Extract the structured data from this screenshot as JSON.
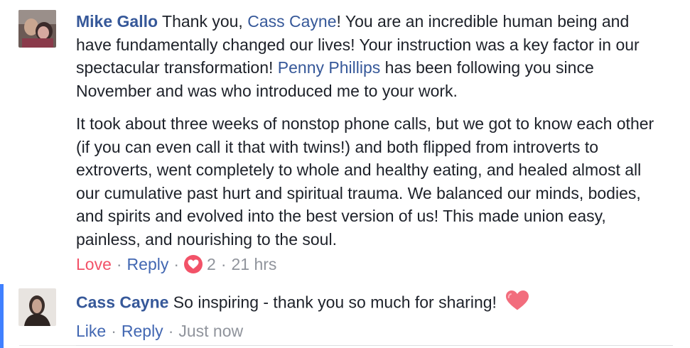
{
  "comment1": {
    "author": "Mike Gallo",
    "p1_a": " Thank you, ",
    "mention1": "Cass Cayne",
    "p1_b": "! You are an incredible human being and have fundamentally changed our lives! Your instruction was a key factor in our spectacular transformation! ",
    "mention2": "Penny Phillips",
    "p1_c": " has been following you since November and was who introduced me to your work.",
    "p2": "It took about three weeks of nonstop phone calls, but we got to know each other (if you can even call it that with twins!) and both flipped from introverts to extroverts, went completely to whole and healthy eating, and healed almost all our cumulative past hurt and spiritual trauma. We balanced our minds, bodies, and spirits and evolved into the best version of us! This made union easy, painless, and nourishing to the soul.",
    "actions": {
      "reaction_label": "Love",
      "reply_label": "Reply",
      "reaction_count": "2",
      "timestamp": "21 hrs"
    }
  },
  "comment2": {
    "author": "Cass Cayne",
    "text": " So inspiring - thank you so much for sharing! ",
    "emoji_icon": "heart-icon",
    "actions": {
      "like_label": "Like",
      "reply_label": "Reply",
      "timestamp": "Just now"
    }
  },
  "colors": {
    "link": "#365899",
    "love": "#f25268",
    "meta": "#90949c",
    "active_bar": "#4080ff"
  }
}
